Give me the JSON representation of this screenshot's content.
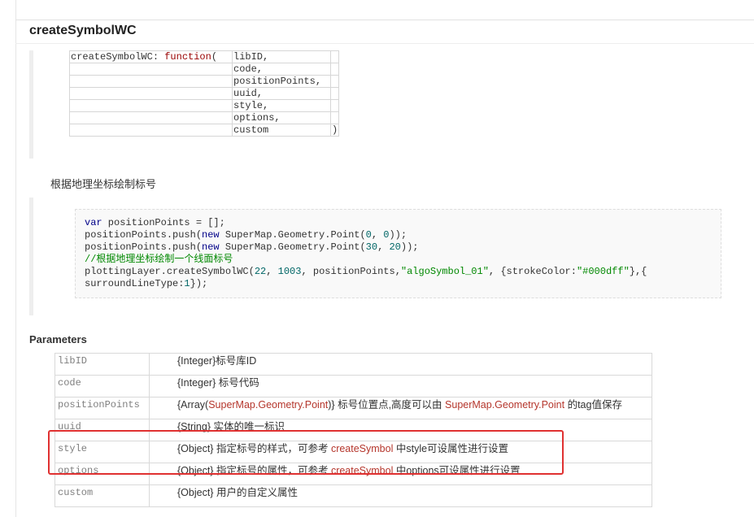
{
  "method": {
    "title": "createSymbolWC"
  },
  "signature": {
    "prefix": "createSymbolWC: ",
    "keyword": "function",
    "paren_open": "(",
    "params": [
      "libID,",
      "code,",
      "positionPoints,",
      "uuid,",
      "style,",
      "options,",
      "custom"
    ],
    "paren_close": ")"
  },
  "description": "根据地理坐标绘制标号",
  "code_example": {
    "lines": [
      [
        {
          "t": "kw",
          "v": "var"
        },
        {
          "t": "pl",
          "v": " positionPoints = [];"
        }
      ],
      [
        {
          "t": "pl",
          "v": "positionPoints.push("
        },
        {
          "t": "kw",
          "v": "new"
        },
        {
          "t": "pl",
          "v": " SuperMap.Geometry.Point("
        },
        {
          "t": "num",
          "v": "0"
        },
        {
          "t": "pl",
          "v": ", "
        },
        {
          "t": "num",
          "v": "0"
        },
        {
          "t": "pl",
          "v": "));"
        }
      ],
      [
        {
          "t": "pl",
          "v": "positionPoints.push("
        },
        {
          "t": "kw",
          "v": "new"
        },
        {
          "t": "pl",
          "v": " SuperMap.Geometry.Point("
        },
        {
          "t": "num",
          "v": "30"
        },
        {
          "t": "pl",
          "v": ", "
        },
        {
          "t": "num",
          "v": "20"
        },
        {
          "t": "pl",
          "v": "));"
        }
      ],
      [
        {
          "t": "cm",
          "v": "//根据地理坐标绘制一个线面标号"
        }
      ],
      [
        {
          "t": "pl",
          "v": "plottingLayer.createSymbolWC("
        },
        {
          "t": "num",
          "v": "22"
        },
        {
          "t": "pl",
          "v": ", "
        },
        {
          "t": "num",
          "v": "1003"
        },
        {
          "t": "pl",
          "v": ", positionPoints,"
        },
        {
          "t": "str",
          "v": "\"algoSymbol_01\""
        },
        {
          "t": "pl",
          "v": ", {strokeColor:"
        },
        {
          "t": "str",
          "v": "\"#000dff\""
        },
        {
          "t": "pl",
          "v": "},{"
        }
      ],
      [
        {
          "t": "pl",
          "v": "surroundLineType:"
        },
        {
          "t": "num",
          "v": "1"
        },
        {
          "t": "pl",
          "v": "});"
        }
      ]
    ]
  },
  "parameters": {
    "heading": "Parameters",
    "rows": [
      {
        "name": "libID",
        "desc": [
          {
            "t": "pl",
            "v": "{Integer}标号库ID"
          }
        ]
      },
      {
        "name": "code",
        "desc": [
          {
            "t": "pl",
            "v": "{Integer} 标号代码"
          }
        ]
      },
      {
        "name": "positionPoints",
        "desc": [
          {
            "t": "pl",
            "v": "{Array("
          },
          {
            "t": "link",
            "v": "SuperMap.Geometry.Point"
          },
          {
            "t": "pl",
            "v": ")} 标号位置点,高度可以由 "
          },
          {
            "t": "link",
            "v": "SuperMap.Geometry.Point"
          },
          {
            "t": "pl",
            "v": " 的tag值保存"
          }
        ]
      },
      {
        "name": "uuid",
        "desc": [
          {
            "t": "pl",
            "v": "{String} 实体的唯一标识"
          }
        ]
      },
      {
        "name": "style",
        "desc": [
          {
            "t": "pl",
            "v": "{Object} 指定标号的样式，可参考 "
          },
          {
            "t": "link",
            "v": "createSymbol"
          },
          {
            "t": "pl",
            "v": " 中style可设属性进行设置"
          }
        ]
      },
      {
        "name": "options",
        "desc": [
          {
            "t": "pl",
            "v": "{Object} 指定标号的属性，可参考 "
          },
          {
            "t": "link",
            "v": "createSymbol"
          },
          {
            "t": "pl",
            "v": " 中options可设属性进行设置"
          }
        ]
      },
      {
        "name": "custom",
        "desc": [
          {
            "t": "pl",
            "v": "{Object} 用户的自定义属性"
          }
        ]
      }
    ]
  },
  "colors": {
    "link": "#b5362c",
    "keyword": "#000088",
    "highlight_border": "#e03131"
  }
}
